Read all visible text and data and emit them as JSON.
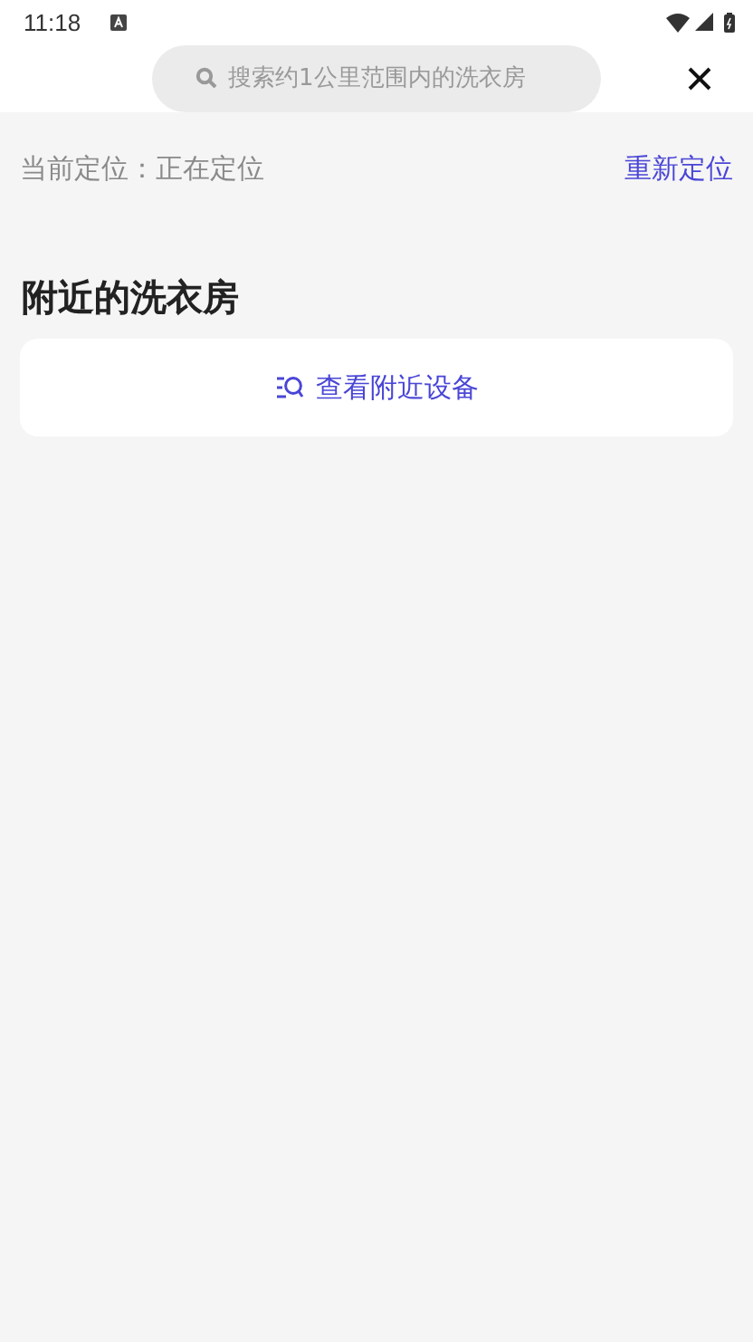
{
  "status_bar": {
    "time": "11:18"
  },
  "search": {
    "placeholder": "搜索约1公里范围内的洗衣房"
  },
  "location": {
    "label": "当前定位：正在定位",
    "action": "重新定位"
  },
  "section": {
    "title": "附近的洗衣房"
  },
  "nearby_button": {
    "label": "查看附近设备"
  }
}
